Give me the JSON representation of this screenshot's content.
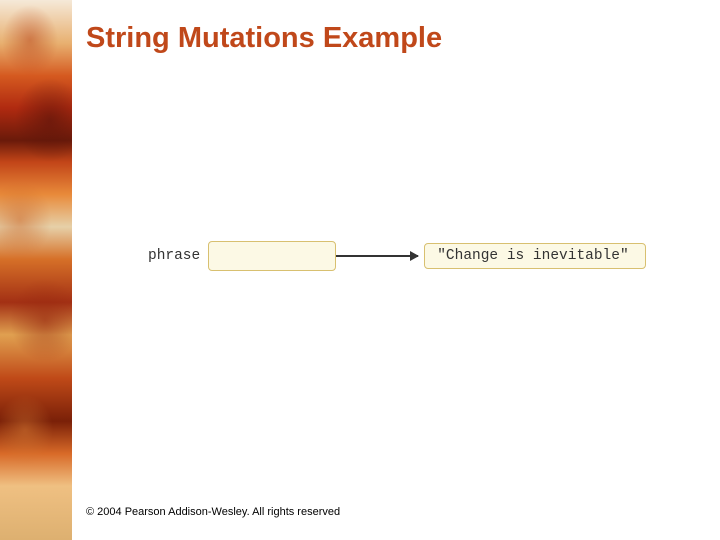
{
  "title": "String Mutations Example",
  "diagram": {
    "variable_label": "phrase",
    "string_value": "\"Change is inevitable\""
  },
  "footer": "© 2004 Pearson Addison-Wesley. All rights reserved"
}
